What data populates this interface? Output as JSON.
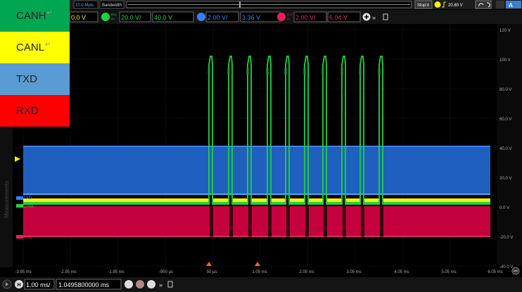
{
  "colors": {
    "canh": "#00a651",
    "canl": "#ffff00",
    "txd": "#5b9bd5",
    "rxd": "#ff0000",
    "scope_bg": "#000000",
    "grid": "#2c3640",
    "trace_green": "#1fd43a",
    "trace_yellow": "#f2ee1a",
    "trace_blue": "#1f5fbf",
    "trace_red": "#c4003f"
  },
  "legend": [
    {
      "key": "canh",
      "label": "CANH",
      "mark": "↵"
    },
    {
      "key": "canl",
      "label": "CANL",
      "mark": "↵"
    },
    {
      "key": "txd",
      "label": "TXD",
      "mark": ""
    },
    {
      "key": "rxd",
      "label": "RXD",
      "mark": ""
    }
  ],
  "top_bar": {
    "sample_rate": "10.0 Mpts",
    "bandwidth": "Bandwidth",
    "stop_label": "Stop'd",
    "trigger_level": "20.80 V"
  },
  "channels": [
    {
      "icon": "ch1",
      "scale": "",
      "offset": "0.0 V",
      "color": "#f2ee1a"
    },
    {
      "icon": "ch2",
      "scale": "20.0 V/",
      "offset": "40.0 V",
      "color": "#1fd43a"
    },
    {
      "icon": "ch3",
      "scale": "2.00 V/",
      "offset": "3.36 V",
      "color": "#3a7ff0"
    },
    {
      "icon": "ch4",
      "scale": "2.00 V/",
      "offset": "6.04 V",
      "color": "#e8205a"
    }
  ],
  "y_axis": {
    "labels": [
      "120 V",
      "100 V",
      "80.0 V",
      "60.0 V",
      "40.0 V",
      "20.0 V",
      "0.0 V",
      "-20.0 V",
      "-40.0 V"
    ]
  },
  "x_axis": {
    "labels": [
      "-3.95 ms",
      "-2.95 ms",
      "-1.95 ms",
      "-950 µs",
      "50 µs",
      "1.05 ms",
      "2.05 ms",
      "3.05 ms",
      "4.05 ms",
      "5.05 ms",
      "6.05 ms"
    ]
  },
  "channel_markers": {
    "txd": "TXD",
    "canl": "CANL",
    "rxd": "RXD"
  },
  "side_label": "Measurements",
  "bottom_bar": {
    "timebase": "1.00 ms/",
    "position": "1.0495800000 ms"
  }
}
